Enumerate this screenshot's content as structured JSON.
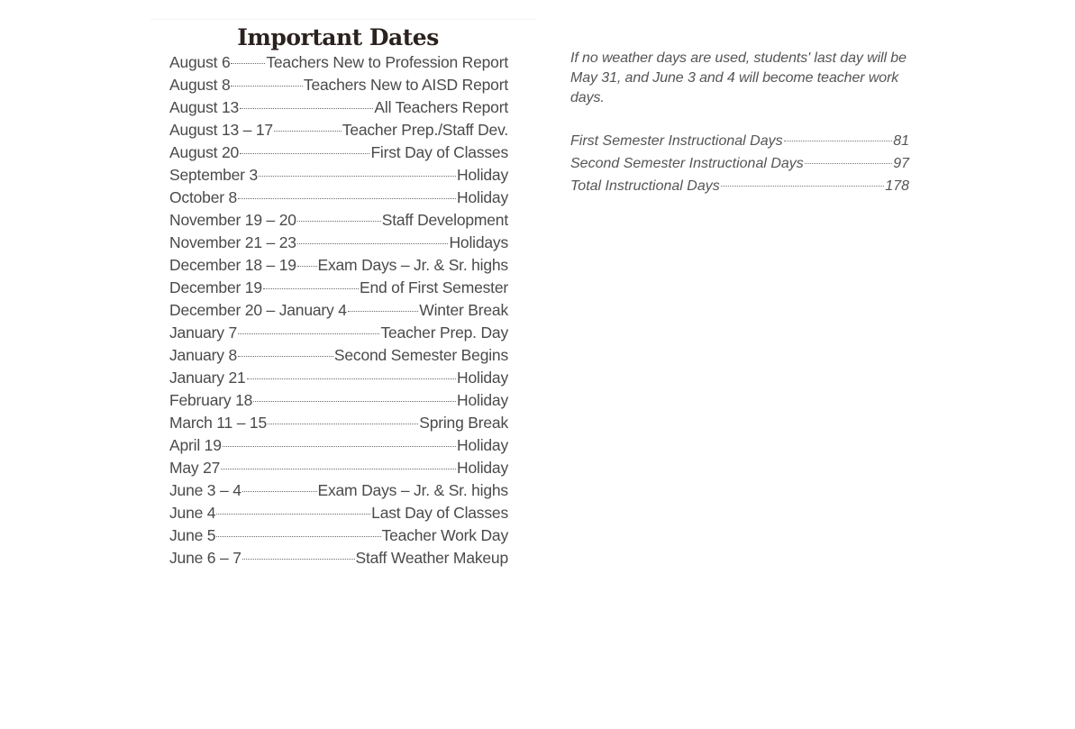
{
  "title": "Important Dates",
  "dates": [
    {
      "date": "August 6",
      "event": "Teachers New to Profession Report"
    },
    {
      "date": "August 8",
      "event": "Teachers New to AISD Report"
    },
    {
      "date": "August 13",
      "event": "All Teachers Report"
    },
    {
      "date": "August 13 – 17",
      "event": "Teacher Prep./Staff Dev."
    },
    {
      "date": "August 20",
      "event": "First Day of Classes"
    },
    {
      "date": "September 3",
      "event": "Holiday"
    },
    {
      "date": "October 8",
      "event": "Holiday"
    },
    {
      "date": "November 19 – 20",
      "event": "Staff Development"
    },
    {
      "date": "November 21 – 23",
      "event": "Holidays"
    },
    {
      "date": "December 18 – 19",
      "event": "Exam Days – Jr. & Sr. highs"
    },
    {
      "date": "December 19",
      "event": "End of First Semester"
    },
    {
      "date": "December 20 – January 4",
      "event": "Winter Break"
    },
    {
      "date": "January 7",
      "event": "Teacher Prep. Day"
    },
    {
      "date": "January 8",
      "event": "Second Semester Begins"
    },
    {
      "date": "January 21",
      "event": "Holiday"
    },
    {
      "date": "February 18",
      "event": "Holiday"
    },
    {
      "date": "March 11 – 15",
      "event": "Spring Break"
    },
    {
      "date": "April 19",
      "event": "Holiday"
    },
    {
      "date": "May 27",
      "event": "Holiday"
    },
    {
      "date": "June 3 – 4",
      "event": "Exam Days – Jr. & Sr. highs"
    },
    {
      "date": "June 4",
      "event": "Last Day of Classes"
    },
    {
      "date": "June 5",
      "event": "Teacher Work Day"
    },
    {
      "date": "June 6 – 7",
      "event": "Staff Weather Makeup"
    }
  ],
  "note": "If no weather days are used, students' last day will be May 31, and June 3 and 4 will become teacher work days.",
  "totals": [
    {
      "label": "First Semester Instructional Days",
      "value": "81"
    },
    {
      "label": "Second Semester Instructional Days",
      "value": "97"
    },
    {
      "label": "Total Instructional Days",
      "value": "178"
    }
  ]
}
